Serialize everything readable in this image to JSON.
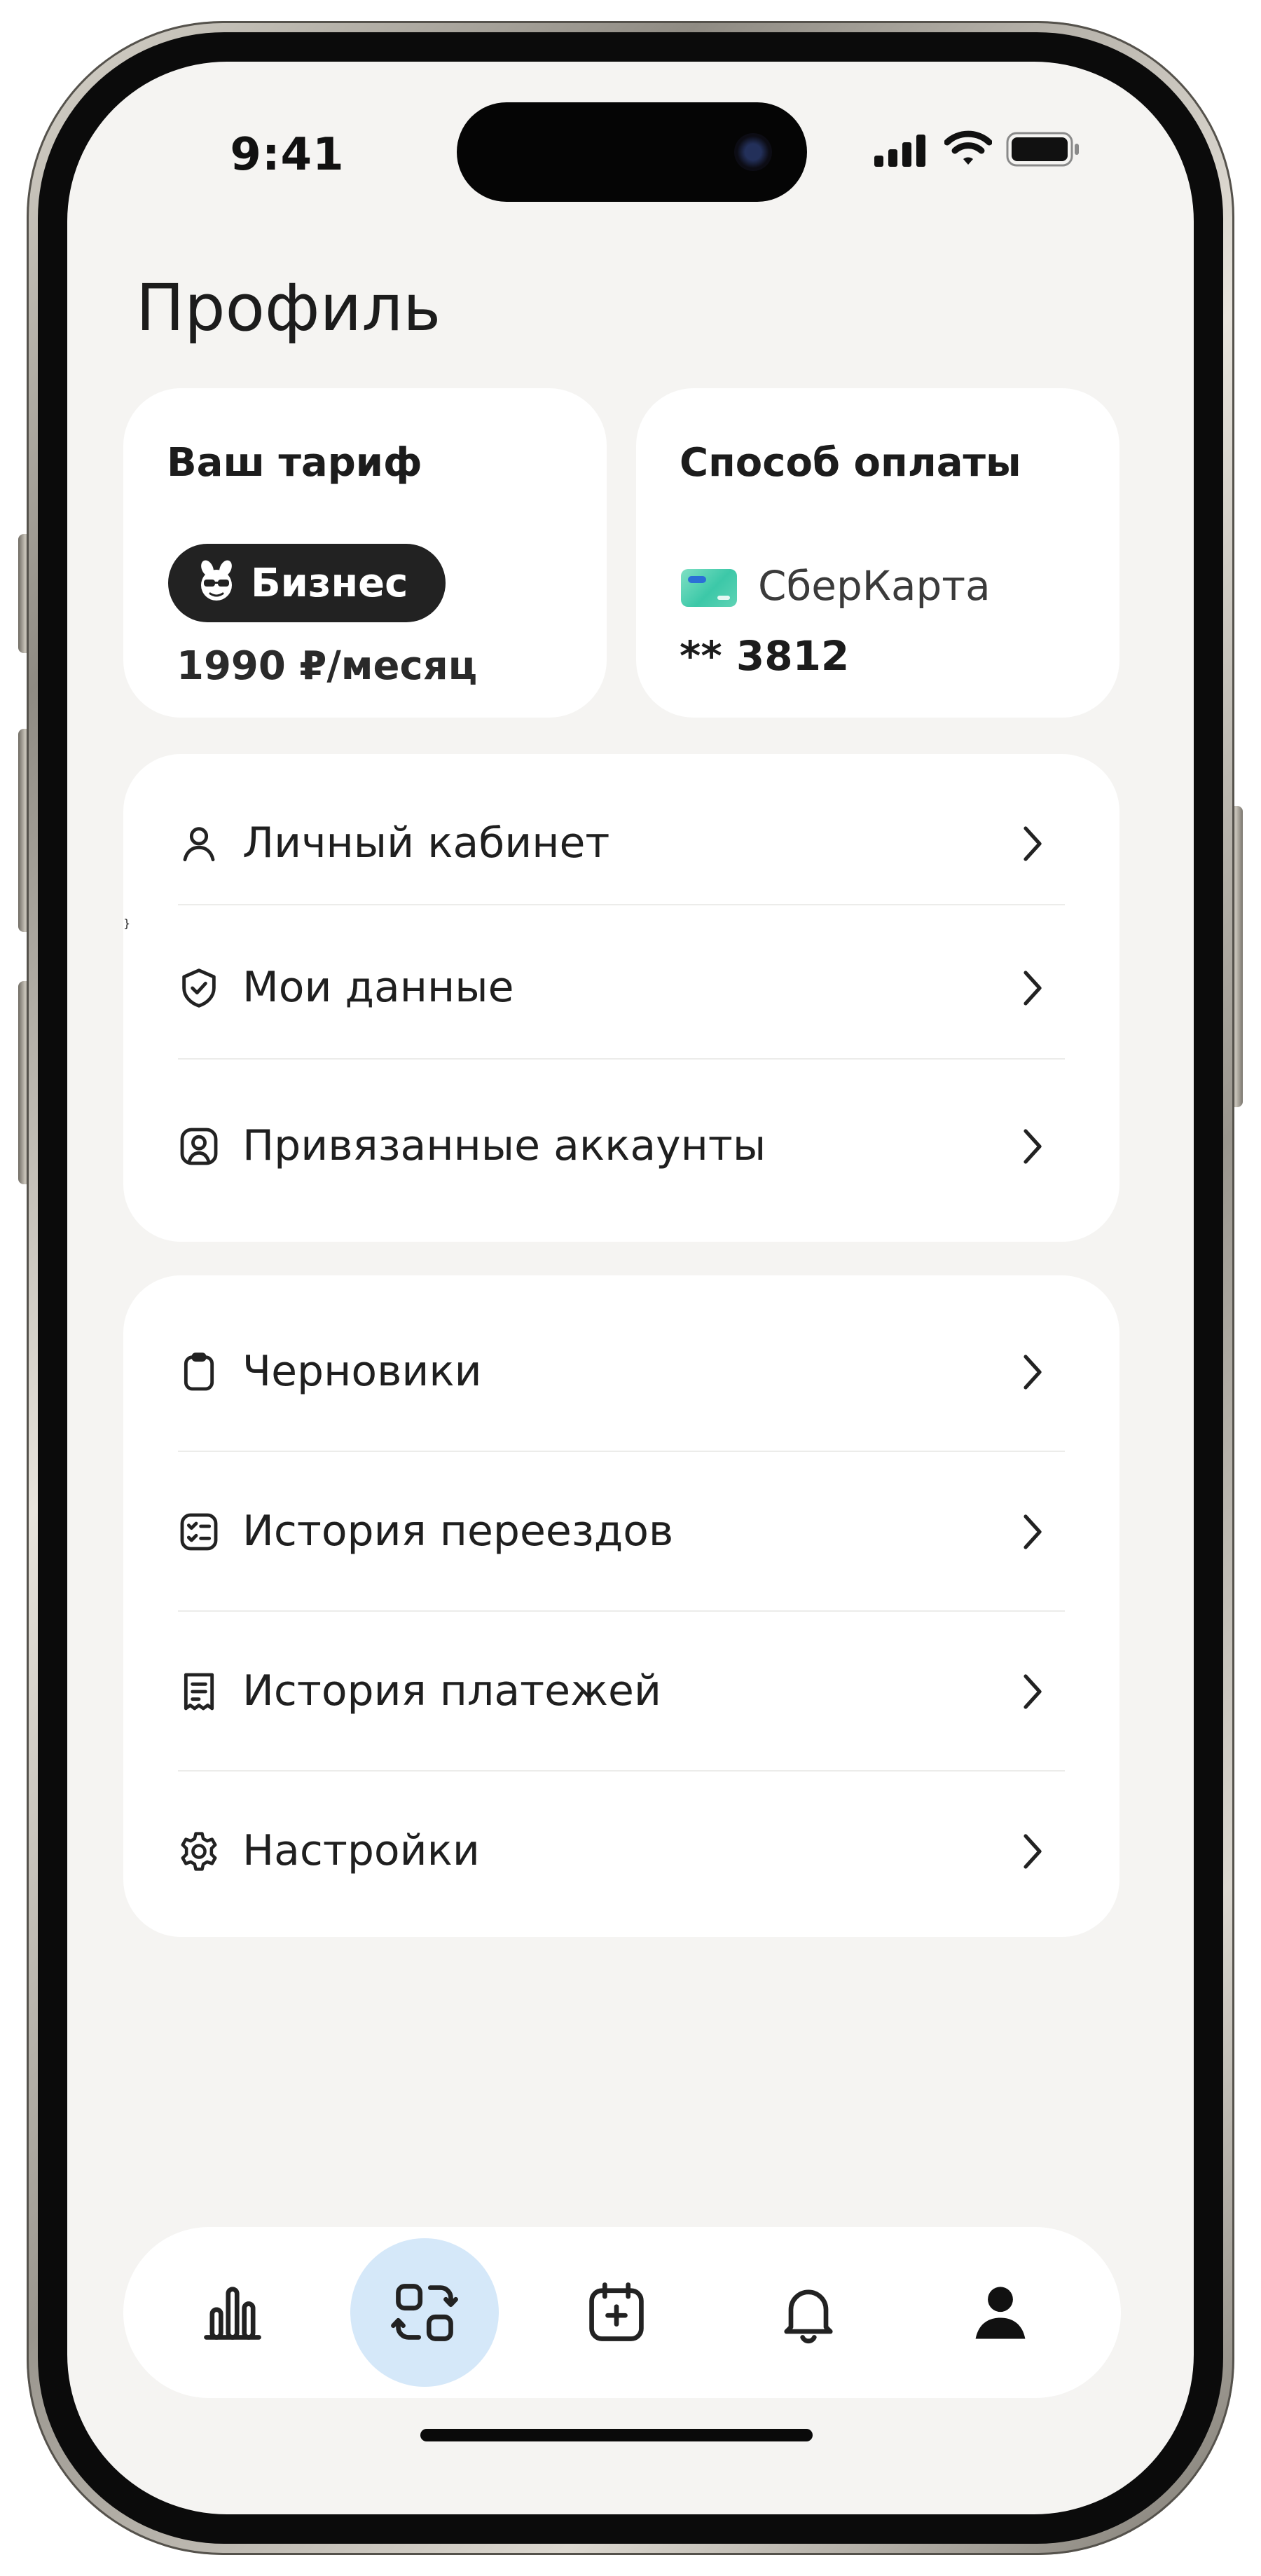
{
  "status_bar": {
    "time": "9:41",
    "icons": [
      "cellular-signal-icon",
      "wifi-icon",
      "battery-icon"
    ]
  },
  "page": {
    "title": "Профиль"
  },
  "tariff_card": {
    "label": "Ваш тариф",
    "plan": "Бизнес",
    "plan_icon": "bee-mascot-icon",
    "price": "1990 ₽/месяц"
  },
  "payment_card": {
    "label": "Способ оплаты",
    "card_icon": "bank-card-icon",
    "card_name": "СберКарта",
    "card_number": "** 3812"
  },
  "menu_group_1": {
    "items": [
      {
        "label": "Личный кабинет",
        "icon": "user-icon"
      },
      {
        "label": "Мои данные",
        "icon": "shield-check-icon"
      },
      {
        "label": "Привязанные аккаунты",
        "icon": "user-square-icon"
      }
    ]
  },
  "menu_group_2": {
    "items": [
      {
        "label": "Черновики",
        "icon": "clipboard-icon"
      },
      {
        "label": "История переездов",
        "icon": "checklist-icon"
      },
      {
        "label": "История платежей",
        "icon": "receipt-icon"
      },
      {
        "label": "Настройки",
        "icon": "gear-icon"
      }
    ]
  },
  "tab_bar": {
    "tabs": [
      {
        "icon": "bar-chart-icon",
        "active": false
      },
      {
        "icon": "shapes-swap-icon",
        "active": true
      },
      {
        "icon": "calendar-plus-icon",
        "active": false
      },
      {
        "icon": "bell-icon",
        "active": false
      },
      {
        "icon": "profile-icon",
        "active": false
      }
    ]
  },
  "colors": {
    "background": "#f5f4f2",
    "card": "#ffffff",
    "accent_tab": "#d5e8f9",
    "plan_pill": "#222222",
    "text": "#1f1f1f"
  }
}
